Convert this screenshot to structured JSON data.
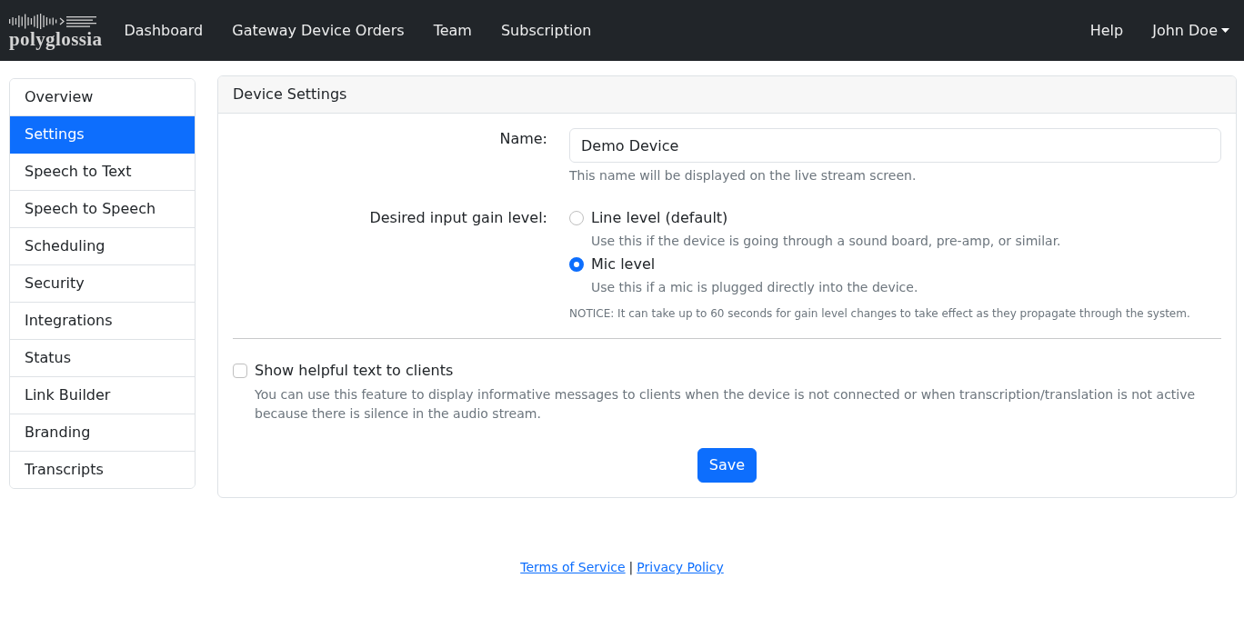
{
  "navbar": {
    "logo": {
      "text": "polyglossia"
    },
    "links": [
      {
        "label": "Dashboard"
      },
      {
        "label": "Gateway Device Orders"
      },
      {
        "label": "Team"
      },
      {
        "label": "Subscription"
      }
    ],
    "right_links": [
      {
        "label": "Help",
        "kind": "link"
      },
      {
        "label": "John Doe",
        "kind": "dropdown"
      }
    ]
  },
  "sidebar": {
    "items": [
      {
        "label": "Overview",
        "selected": false
      },
      {
        "label": "Settings",
        "selected": true
      },
      {
        "label": "Speech to Text",
        "selected": false
      },
      {
        "label": "Speech to Speech",
        "selected": false
      },
      {
        "label": "Scheduling",
        "selected": false
      },
      {
        "label": "Security",
        "selected": false
      },
      {
        "label": "Integrations",
        "selected": false
      },
      {
        "label": "Status",
        "selected": false
      },
      {
        "label": "Link Builder",
        "selected": false
      },
      {
        "label": "Branding",
        "selected": false
      },
      {
        "label": "Transcripts",
        "selected": false
      }
    ]
  },
  "card": {
    "title": "Device Settings",
    "name_field": {
      "label": "Name:",
      "value": "Demo Device",
      "help": "This name will be displayed on the live stream screen."
    },
    "gain": {
      "label": "Desired input gain level:",
      "options": [
        {
          "label": "Line level (default)",
          "help": "Use this if the device is going through a sound board, pre-amp, or similar.",
          "selected": false
        },
        {
          "label": "Mic level",
          "help": "Use this if a mic is plugged directly into the device.",
          "selected": true
        }
      ],
      "notice": "NOTICE: It can take up to 60 seconds for gain level changes to take effect as they propagate through the system."
    },
    "helpful_text": {
      "label": "Show helpful text to clients",
      "checked": false,
      "help": "You can use this feature to display informative messages to clients when the device is not connected or when transcription/translation is not active because there is silence in the audio stream."
    },
    "save_button": "Save"
  },
  "footer": {
    "links": [
      "Terms of Service",
      "Privacy Policy"
    ],
    "separator": "|"
  }
}
